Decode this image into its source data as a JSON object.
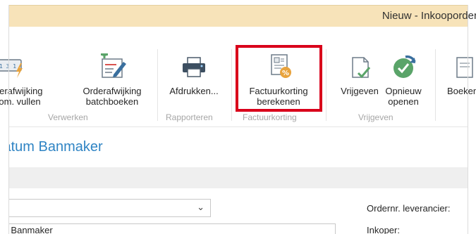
{
  "window": {
    "title": "Nieuw - Inkooporder"
  },
  "ribbon": {
    "groups": {
      "verwerken": "Verwerken",
      "rapporteren": "Rapporteren",
      "factuurkorting": "Factuurkorting",
      "vrijgeven": "Vrijgeven"
    },
    "buttons": {
      "autom_vullen": {
        "line1": "Orderafwijking",
        "line2": "autom. vullen"
      },
      "batchboeken": {
        "line1": "Orderafwijking",
        "line2": "batchboeken"
      },
      "afdrukken": {
        "line1": "Afdrukken..."
      },
      "factuurkorting": {
        "line1": "Factuurkorting",
        "line2": "berekenen"
      },
      "vrijgeven": {
        "line1": "Vrijgeven"
      },
      "opnieuw_openen": {
        "line1": "Opnieuw",
        "line2": "openen"
      },
      "boeken": {
        "line1": "Boeken"
      }
    }
  },
  "page": {
    "title": "Adatum Banmaker"
  },
  "form": {
    "vendor_select_value": "",
    "vendor_name_value": "Adatum Banmaker",
    "ordernr_label": "Ordernr. leverancier:",
    "inkoper_label": "Inkoper:"
  },
  "colors": {
    "titlebar": "#f7e3b9",
    "highlight": "#d9001b",
    "page_title": "#2f84c4",
    "icon_blue": "#3a6f9e",
    "icon_green": "#5aa469",
    "icon_orange": "#e8a33d"
  }
}
